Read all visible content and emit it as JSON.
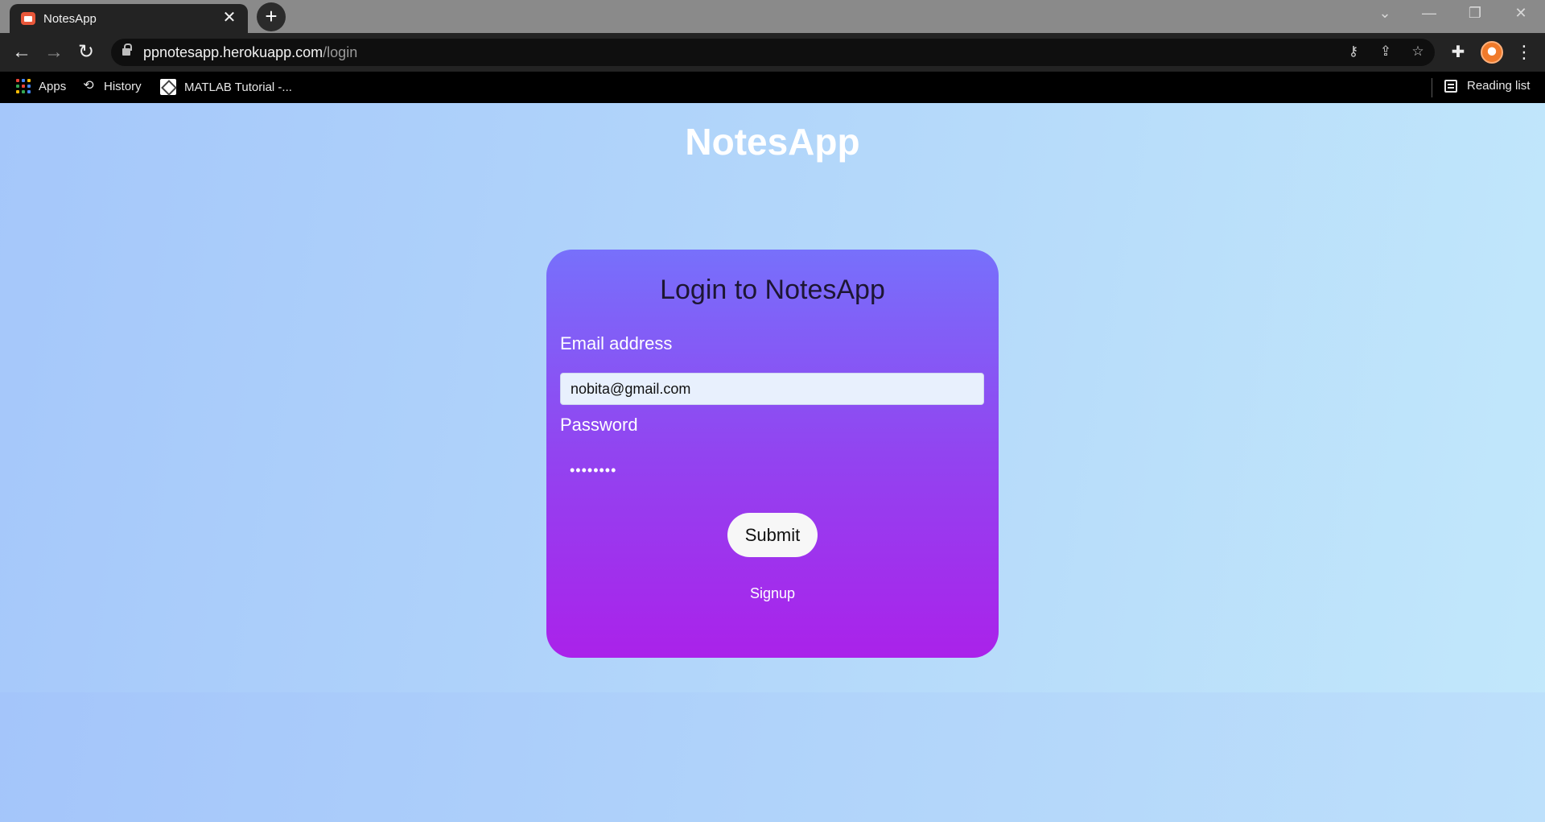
{
  "browser": {
    "tab": {
      "title": "NotesApp",
      "close_glyph": "✕"
    },
    "new_tab_glyph": "+",
    "window_controls": {
      "dropdown": "⌄",
      "minimize": "—",
      "restore": "❐",
      "close": "✕"
    },
    "nav": {
      "back": "←",
      "forward": "→",
      "reload": "↻"
    },
    "url": {
      "host": "ppnotesapp.herokuapp.com",
      "path": "/login"
    },
    "omnibox_icons": {
      "key": "⚷",
      "share": "⇪",
      "star": "☆"
    },
    "extensions_glyph": "✚",
    "menu_glyph": "⋮",
    "bookmarks": [
      {
        "label": "Apps",
        "icon": "apps-grid-icon"
      },
      {
        "label": "History",
        "icon": "history-icon",
        "glyph": "⟲"
      },
      {
        "label": "MATLAB Tutorial -...",
        "icon": "matlab-icon"
      }
    ],
    "reading_list": "Reading list",
    "colors": {
      "tab_bar": "#8a8a8a",
      "toolbar": "#232323",
      "bookmarks_bar": "#000000"
    }
  },
  "page": {
    "brand": "NotesApp",
    "login": {
      "title": "Login to NotesApp",
      "email_label": "Email address",
      "email_value": "nobita@gmail.com",
      "password_label": "Password",
      "password_value": "password",
      "submit_label": "Submit",
      "signup_label": "Signup"
    },
    "colors": {
      "background_start": "#a5c7fa",
      "background_end": "#c2e8fb",
      "card_top": "#7770fb",
      "card_bottom": "#aa22ea",
      "title_text": "#1d1633"
    }
  }
}
